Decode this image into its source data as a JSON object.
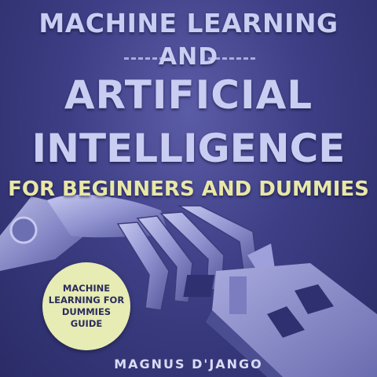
{
  "cover": {
    "title_line_1": "MACHINE LEARNING",
    "title_line_2": "AND",
    "title_line_3": "ARTIFICIAL",
    "title_line_4": "INTELLIGENCE",
    "subtitle": "FOR BEGINNERS AND DUMMIES",
    "badge_lines": [
      "MACHINE",
      "LEARNING FOR",
      "DUMMIES",
      "GUIDE"
    ],
    "author": "MAGNUS D'JANGO"
  },
  "colors": {
    "background": "#3d3e85",
    "title_text": "#c9cdf2",
    "subtitle_text": "#e8e7a6",
    "badge_fill": "#e6ecb3",
    "badge_text": "#2b2b5c"
  }
}
